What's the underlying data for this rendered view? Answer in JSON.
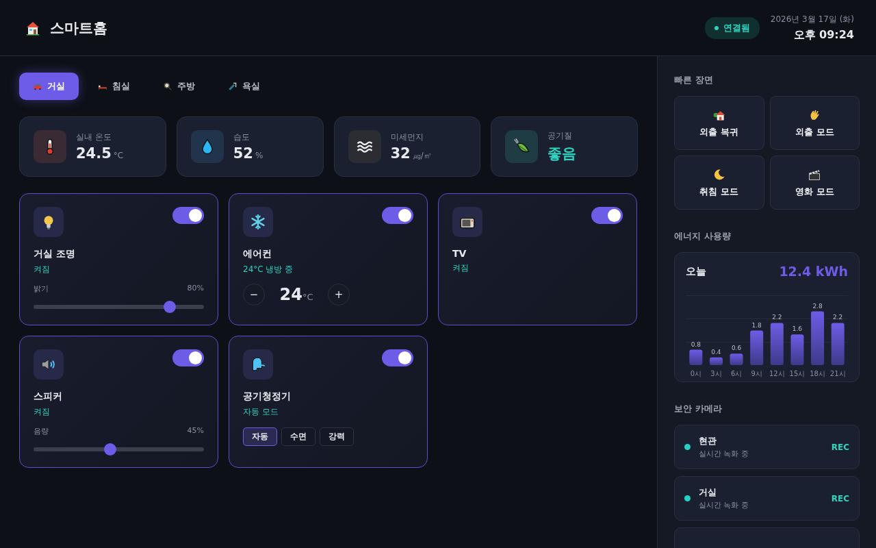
{
  "header": {
    "title": "스마트홈",
    "connection": "연결됨",
    "date": "2026년 3월 17일 (화)",
    "time": "오후 09:24"
  },
  "rooms": [
    {
      "label": "거실",
      "selected": true
    },
    {
      "label": "침실",
      "selected": false
    },
    {
      "label": "주방",
      "selected": false
    },
    {
      "label": "욕실",
      "selected": false
    }
  ],
  "stats": [
    {
      "label": "실내 온도",
      "value": "24.5",
      "unit": "°C",
      "kind": "reading"
    },
    {
      "label": "습도",
      "value": "52",
      "unit": "%",
      "kind": "reading"
    },
    {
      "label": "미세먼지",
      "value": "32",
      "unit": "㎍/㎥",
      "kind": "reading"
    },
    {
      "label": "공기질",
      "value": "좋음",
      "kind": "rating"
    }
  ],
  "devices": [
    {
      "name": "거실 조명",
      "status": "켜짐",
      "on": true,
      "kind": "slider",
      "slider_label": "밝기",
      "reading": "80%",
      "level": 0.8
    },
    {
      "name": "에어컨",
      "status": "24°C 냉방 중",
      "on": true,
      "kind": "thermostat",
      "minus": "−",
      "setpoint": "24",
      "unit": "°C",
      "plus": "+"
    },
    {
      "name": "TV",
      "status": "켜짐",
      "on": true,
      "kind": "plain"
    },
    {
      "name": "스피커",
      "status": "켜짐",
      "on": true,
      "kind": "slider",
      "slider_label": "음량",
      "reading": "45%",
      "level": 0.45
    },
    {
      "name": "공기청정기",
      "status": "자동 모드",
      "on": true,
      "kind": "modes",
      "modes": [
        {
          "label": "자동",
          "selected": true
        },
        {
          "label": "수면",
          "selected": false
        },
        {
          "label": "강력",
          "selected": false
        }
      ]
    }
  ],
  "scenes": {
    "title": "빠른 장면",
    "items": [
      "외출 복귀",
      "외출 모드",
      "취침 모드",
      "영화 모드"
    ]
  },
  "energy": {
    "title": "에너지 사용량",
    "period": "오늘",
    "total": "12.4 kWh",
    "chart_data": {
      "type": "bar",
      "categories": [
        "0시",
        "3시",
        "6시",
        "9시",
        "12시",
        "15시",
        "18시",
        "21시"
      ],
      "values": [
        0.8,
        0.4,
        0.6,
        1.8,
        2.2,
        1.6,
        2.8,
        2.2
      ],
      "data_labels": true
    }
  },
  "cameras": {
    "title": "보안 카메라",
    "items": [
      {
        "name": "현관",
        "status": "실시간 녹화 중",
        "badge": "REC",
        "color": "#22d3c5"
      },
      {
        "name": "거실",
        "status": "실시간 녹화 중",
        "badge": "REC",
        "color": "#22d3c5"
      }
    ]
  }
}
